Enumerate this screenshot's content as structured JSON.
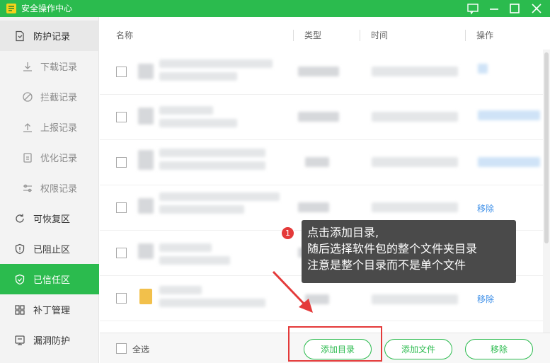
{
  "window": {
    "title": "安全操作中心",
    "accent": "#2bbb4e",
    "controls": [
      "feedback-icon",
      "minimize-icon",
      "maximize-icon",
      "close-icon"
    ]
  },
  "sidebar": {
    "items": [
      {
        "label": "防护记录",
        "icon": "document-icon"
      },
      {
        "label": "下载记录",
        "icon": "download-icon"
      },
      {
        "label": "拦截记录",
        "icon": "block-icon"
      },
      {
        "label": "上报记录",
        "icon": "upload-icon"
      },
      {
        "label": "优化记录",
        "icon": "clipboard-icon"
      },
      {
        "label": "权限记录",
        "icon": "sliders-icon"
      },
      {
        "label": "可恢复区",
        "icon": "refresh-icon"
      },
      {
        "label": "已阻止区",
        "icon": "shield-alert-icon"
      },
      {
        "label": "已信任区",
        "icon": "shield-check-icon"
      },
      {
        "label": "补丁管理",
        "icon": "grid-icon"
      },
      {
        "label": "漏洞防护",
        "icon": "bug-icon"
      }
    ]
  },
  "table": {
    "columns": [
      "名称",
      "类型",
      "时间",
      "操作"
    ],
    "remove_label": "移除"
  },
  "footer": {
    "select_all": "全选",
    "add_dir": "添加目录",
    "add_file": "添加文件",
    "remove": "移除"
  },
  "tooltip": {
    "step": "1",
    "lines": [
      "点击添加目录,",
      "随后选择软件包的整个文件夹目录",
      "注意是整个目录而不是单个文件"
    ]
  }
}
